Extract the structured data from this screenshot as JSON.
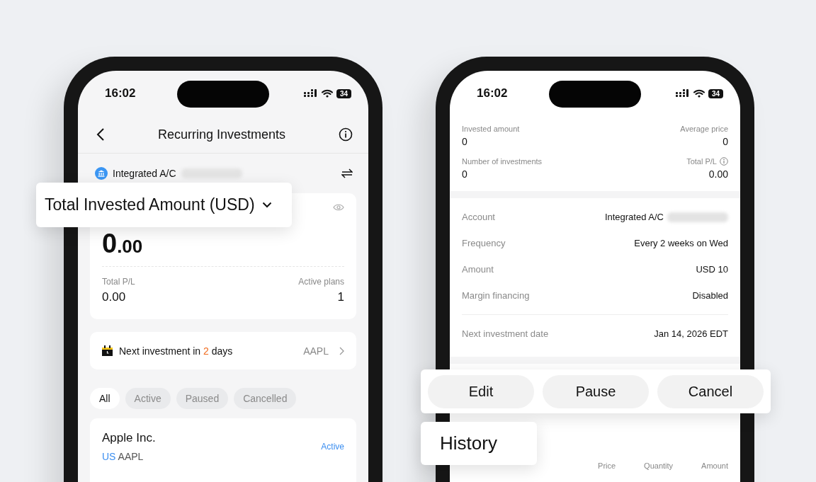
{
  "left_phone": {
    "status_bar": {
      "time": "16:02",
      "battery": "34"
    },
    "header": {
      "title": "Recurring Investments"
    },
    "account": {
      "name": "Integrated A/C",
      "redacted": true
    },
    "summary": {
      "label": "Total Invested Amount (USD)",
      "amount_whole": "0",
      "amount_fraction": ".00",
      "stats": [
        {
          "label": "Total P/L",
          "value": "0.00"
        },
        {
          "label": "Active plans",
          "value": "1"
        }
      ]
    },
    "next_investment": {
      "prefix": "Next investment in",
      "count": "2",
      "suffix": "days",
      "symbol": "AAPL"
    },
    "filters": [
      {
        "label": "All",
        "selected": true
      },
      {
        "label": "Active",
        "selected": false
      },
      {
        "label": "Paused",
        "selected": false
      },
      {
        "label": "Cancelled",
        "selected": false
      }
    ],
    "plans": [
      {
        "name": "Apple Inc.",
        "market": "US",
        "symbol": "AAPL",
        "status": "Active"
      }
    ]
  },
  "right_phone": {
    "status_bar": {
      "time": "16:02",
      "battery": "34"
    },
    "stats": [
      {
        "label": "Invested amount",
        "value": "0",
        "info": false
      },
      {
        "label": "Average price",
        "value": "0",
        "info": false
      },
      {
        "label": "Number of investments",
        "value": "0",
        "info": false
      },
      {
        "label": "Total P/L",
        "value": "0.00",
        "info": true
      }
    ],
    "detail_groups": [
      {
        "rows": [
          {
            "label": "Account",
            "value": "Integrated A/C",
            "redacted": true
          },
          {
            "label": "Frequency",
            "value": "Every 2 weeks on Wed",
            "redacted": false
          },
          {
            "label": "Amount",
            "value": "USD 10",
            "redacted": false
          },
          {
            "label": "Margin financing",
            "value": "Disabled",
            "redacted": false
          }
        ]
      },
      {
        "rows": [
          {
            "label": "Next investment date",
            "value": "Jan 14, 2026 EDT",
            "redacted": false
          }
        ]
      }
    ],
    "actions": [
      "Edit",
      "Pause",
      "Cancel"
    ],
    "history": {
      "title": "History",
      "columns": [
        "Price",
        "Quantity",
        "Amount"
      ]
    }
  }
}
